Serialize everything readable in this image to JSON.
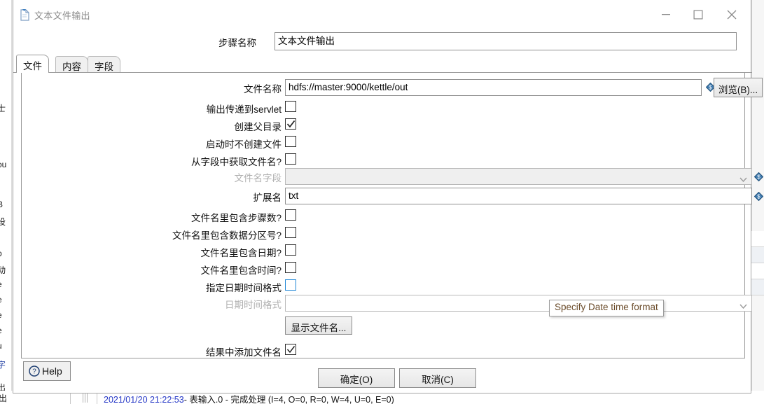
{
  "window": {
    "title": "文本文件输出",
    "icon": "document-output-icon",
    "controls": {
      "minimize": "minimize-icon",
      "maximize": "maximize-icon",
      "close": "close-icon"
    }
  },
  "step": {
    "label": "步骤名称",
    "value": "文本文件输出"
  },
  "tabs": [
    {
      "label": "文件",
      "active": true
    },
    {
      "label": "内容",
      "active": false
    },
    {
      "label": "字段",
      "active": false
    }
  ],
  "form": {
    "filename": {
      "label": "文件名称",
      "value": "hdfs://master:9000/kettle/out",
      "browse_label": "浏览(B)..."
    },
    "pass_to_servlet": {
      "label": "输出传递到servlet",
      "checked": false
    },
    "create_parent_folder": {
      "label": "创建父目录",
      "checked": true
    },
    "do_not_create_at_start": {
      "label": "启动时不创建文件",
      "checked": false
    },
    "filename_from_field": {
      "label": "从字段中获取文件名?",
      "checked": false
    },
    "filename_field": {
      "label": "文件名字段",
      "value": "",
      "enabled": false
    },
    "extension": {
      "label": "扩展名",
      "value": "txt"
    },
    "include_stepnr": {
      "label": "文件名里包含步骤数?",
      "checked": false
    },
    "include_partnr": {
      "label": "文件名里包含数据分区号?",
      "checked": false
    },
    "include_date": {
      "label": "文件名里包含日期?",
      "checked": false
    },
    "include_time": {
      "label": "文件名里包含时间?",
      "checked": false
    },
    "specify_format": {
      "label": "指定日期时间格式",
      "checked": false,
      "focused": true
    },
    "date_time_format": {
      "label": "日期时间格式",
      "value": "",
      "enabled": false
    },
    "show_filenames": {
      "label": "显示文件名..."
    },
    "add_to_result": {
      "label": "结果中添加文件名",
      "checked": true
    }
  },
  "tooltip": {
    "text": "Specify Date time format"
  },
  "footer": {
    "help": "Help",
    "ok": "确定(O)",
    "cancel": "取消(C)"
  },
  "background": {
    "left_fragments": [
      "士",
      "ou",
      "B",
      "设",
      "p",
      "动",
      "e",
      "e",
      "e",
      "e",
      "u",
      "字",
      "出",
      "出"
    ],
    "log_line_time": "2021/01/20 21:22:53",
    "log_line_text": "- 表输入.0 - 完成处理 (I=4, O=0, R=0, W=4, U=0, E=0)"
  },
  "colors": {
    "accent_focus": "#1f86d6",
    "variable_icon": "#2f6ea5",
    "log_text": "#2436c6",
    "tooltip_text": "#6a4b2a"
  }
}
